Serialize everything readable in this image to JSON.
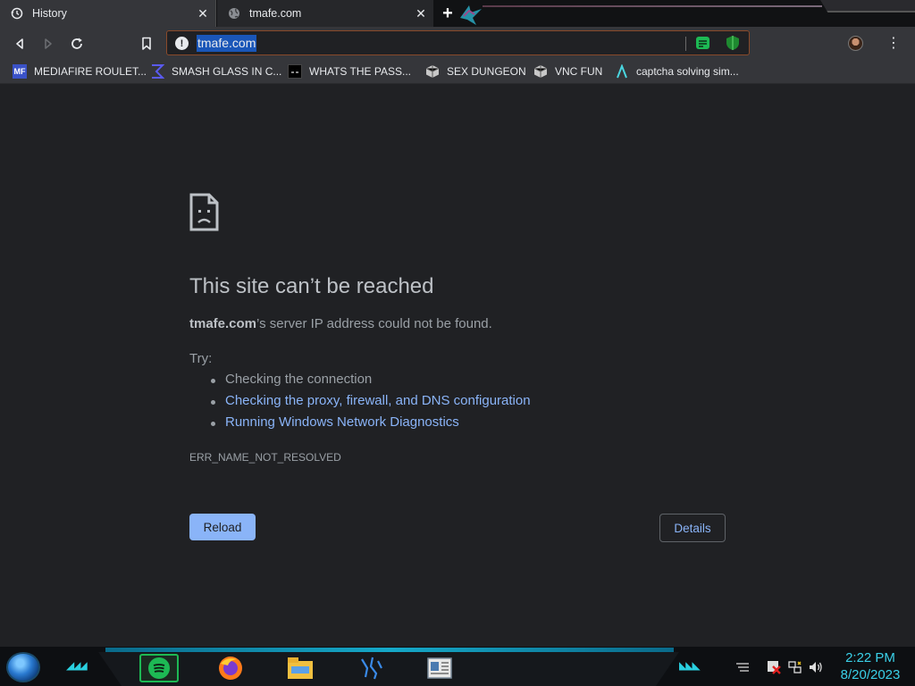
{
  "tabs": [
    {
      "label": "History",
      "icon": "history-icon",
      "active": true
    },
    {
      "label": "tmafe.com",
      "icon": "globe-icon",
      "active": false
    }
  ],
  "omnibox": {
    "url": "tmafe.com"
  },
  "bookmarks": [
    {
      "label": "MEDIAFIRE ROULET...",
      "icon_text": "MF"
    },
    {
      "label": "SMASH GLASS IN C...",
      "icon_text": ""
    },
    {
      "label": "WHATS THE PASS...",
      "icon_text": ""
    },
    {
      "label": "SEX DUNGEON",
      "icon_text": ""
    },
    {
      "label": "VNC FUN",
      "icon_text": ""
    },
    {
      "label": "captcha solving sim...",
      "icon_text": ""
    }
  ],
  "error_page": {
    "title": "This site can’t be reached",
    "host": "tmafe.com",
    "description_suffix": "’s server IP address could not be found.",
    "try_label": "Try:",
    "suggestions": [
      "Checking the connection",
      "Checking the proxy, firewall, and DNS configuration",
      "Running Windows Network Diagnostics"
    ],
    "error_code": "ERR_NAME_NOT_RESOLVED",
    "reload_label": "Reload",
    "details_label": "Details"
  },
  "taskbar": {
    "apps": [
      "spotify-icon",
      "firefox-icon",
      "file-explorer-icon",
      "network-tool-icon",
      "document-viewer-icon"
    ],
    "clock_time": "2:22 PM",
    "clock_date": "8/20/2023"
  },
  "colors": {
    "background": "#202124",
    "link": "#8ab4f8",
    "title_text": "#bdc1c6",
    "body_text": "#9aa0a6",
    "clock": "#3ad0e8"
  }
}
